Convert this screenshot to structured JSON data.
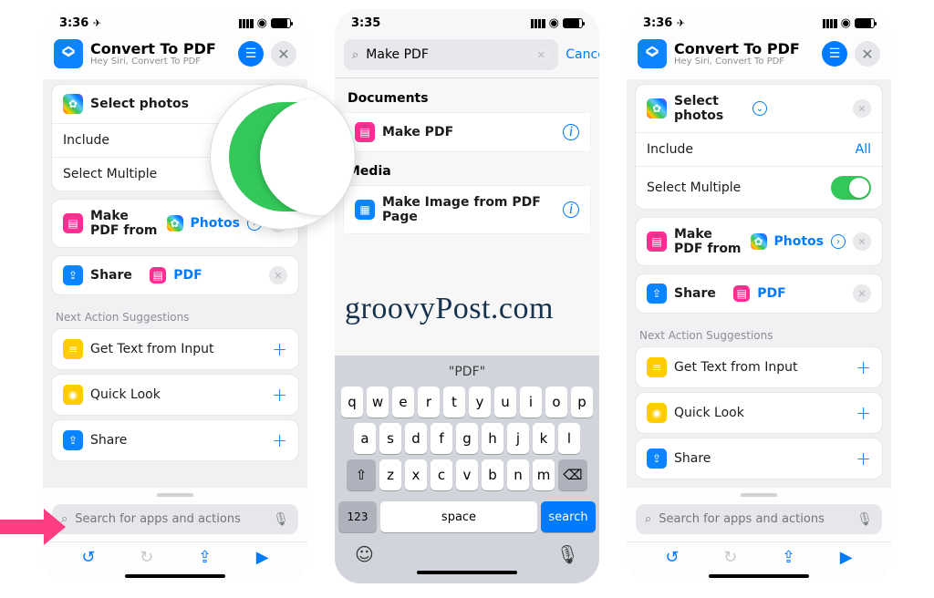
{
  "watermark": "groovyPost.com",
  "phone_left": {
    "time": "3:36",
    "title": "Convert To PDF",
    "subtitle": "Hey Siri, Convert To PDF",
    "select_photos": "Select photos",
    "row_include": "Include",
    "row_multiple": "Select Multiple",
    "make_pdf_prefix": "Make PDF from",
    "make_pdf_param": "Photos",
    "share_label": "Share",
    "share_param": "PDF",
    "suggest_title": "Next Action Suggestions",
    "suggest": [
      "Get Text from Input",
      "Quick Look",
      "Share"
    ],
    "search_placeholder": "Search for apps and actions"
  },
  "phone_mid": {
    "time": "3:35",
    "search_value": "Make PDF",
    "cancel": "Cancel",
    "sec_documents": "Documents",
    "res_makepdf": "Make PDF",
    "sec_media": "Media",
    "res_image": "Make Image from PDF Page",
    "kb_suggest": "\"PDF\"",
    "kb_rows": [
      [
        "q",
        "w",
        "e",
        "r",
        "t",
        "y",
        "u",
        "i",
        "o",
        "p"
      ],
      [
        "a",
        "s",
        "d",
        "f",
        "g",
        "h",
        "j",
        "k",
        "l"
      ],
      [
        "z",
        "x",
        "c",
        "v",
        "b",
        "n",
        "m"
      ]
    ],
    "kb_123": "123",
    "kb_space": "space",
    "kb_search": "search"
  },
  "phone_right": {
    "time": "3:36",
    "title": "Convert To PDF",
    "subtitle": "Hey Siri, Convert To PDF",
    "select_photos": "Select photos",
    "row_include": "Include",
    "include_value": "All",
    "row_multiple": "Select Multiple",
    "make_pdf_prefix": "Make PDF from",
    "make_pdf_param": "Photos",
    "share_label": "Share",
    "share_param": "PDF",
    "suggest_title": "Next Action Suggestions",
    "suggest": [
      "Get Text from Input",
      "Quick Look",
      "Share"
    ],
    "search_placeholder": "Search for apps and actions"
  }
}
